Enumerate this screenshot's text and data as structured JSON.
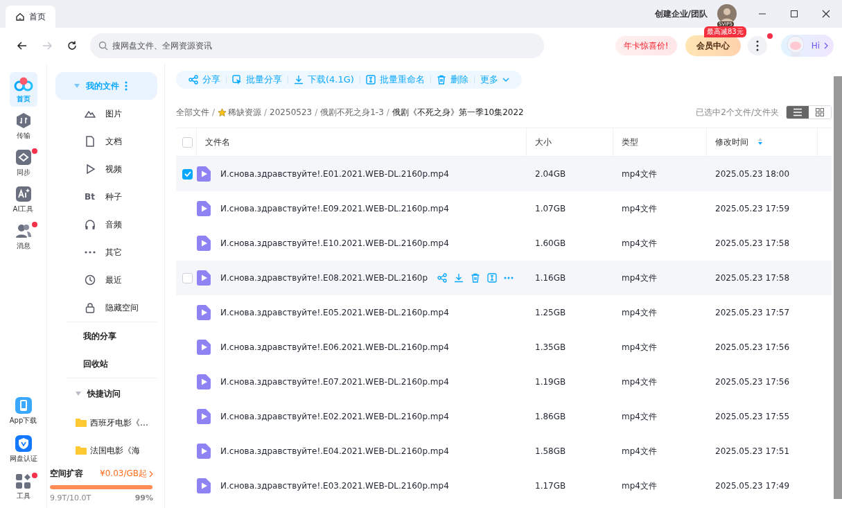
{
  "window": {
    "tab": {
      "label": "首页",
      "selected": true
    },
    "team_link": "创建企业/团队",
    "avatar_badge": "SVIP5"
  },
  "nav": {
    "forward_disabled": true,
    "search": {
      "placeholder": "搜网盘文件、全网资源资讯"
    },
    "promo": "年卡惊喜价!",
    "vip": {
      "label": "会员中心",
      "badge": "最高减83元"
    },
    "more_dot": true,
    "assistant": "Hi"
  },
  "rail": {
    "items": [
      {
        "label": "首页",
        "kind": "home",
        "selected": true,
        "dot": false
      },
      {
        "label": "传输",
        "kind": "transfer",
        "selected": false,
        "dot": false
      },
      {
        "label": "同步",
        "kind": "sync",
        "selected": false,
        "dot": true
      },
      {
        "label": "AI工具",
        "kind": "ai",
        "selected": false,
        "dot": false
      },
      {
        "label": "消息",
        "kind": "people",
        "selected": false,
        "dot": true
      }
    ],
    "bottom": [
      {
        "label": "App下载",
        "kind": "phone",
        "dot": false
      },
      {
        "label": "网盘认证",
        "kind": "shield",
        "dot": false
      },
      {
        "label": "工具",
        "kind": "grid",
        "dot": true
      }
    ]
  },
  "sidebar": {
    "my_files": {
      "label": "我的文件",
      "expanded": true,
      "selected": true
    },
    "categories": [
      {
        "label": "图片",
        "kind": "image"
      },
      {
        "label": "文档",
        "kind": "doc"
      },
      {
        "label": "视频",
        "kind": "video"
      },
      {
        "label": "种子",
        "kind": "bt"
      },
      {
        "label": "音频",
        "kind": "audio"
      },
      {
        "label": "其它",
        "kind": "other"
      },
      {
        "label": "最近",
        "kind": "recent"
      },
      {
        "label": "隐藏空间",
        "kind": "lock"
      }
    ],
    "bt_mark": "Bt",
    "links": [
      "我的分享",
      "回收站"
    ],
    "quick_access": {
      "label": "快捷访问",
      "expanded": true,
      "folders": [
        "西班牙电影《…",
        "法国电影《海"
      ]
    },
    "storage": {
      "title": "空间扩容",
      "offer": "¥0.03/GB起",
      "level": 0.99,
      "usage": "9.9T/10.0T",
      "percent": "99%"
    }
  },
  "toolbar": [
    {
      "label": "分享",
      "kind": "share"
    },
    {
      "label": "批量分享",
      "kind": "batch-share"
    },
    {
      "label": "下载(4.1G)",
      "kind": "download"
    },
    {
      "label": "批量重命名",
      "kind": "rename"
    },
    {
      "label": "删除",
      "kind": "delete"
    },
    {
      "label": "更多",
      "kind": "more"
    }
  ],
  "breadcrumb_separator": "/",
  "breadcrumb": [
    {
      "label": "全部文件",
      "starred": false
    },
    {
      "label": "稀缺资源",
      "starred": true
    },
    {
      "label": "20250523",
      "starred": false
    },
    {
      "label": "俄剧不死之身1-3",
      "starred": false
    },
    {
      "label": "俄剧《不死之身》第一季10集2022",
      "starred": false
    }
  ],
  "selection_info": "已选中2个文件/文件夹",
  "view_modes": [
    {
      "kind": "list",
      "selected": true
    },
    {
      "kind": "grid",
      "selected": false
    }
  ],
  "table": {
    "all_checked": false,
    "columns": [
      "文件名",
      "大小",
      "类型",
      "修改时间"
    ],
    "rows": [
      {
        "name": "И.снова.здравствуйте!.E01.2021.WEB-DL.2160p.mp4",
        "size": "2.04GB",
        "type": "mp4文件",
        "modified": "2025.05.23 18:00",
        "checked": true,
        "hovered": false
      },
      {
        "name": "И.снова.здравствуйте!.E09.2021.WEB-DL.2160p.mp4",
        "size": "1.07GB",
        "type": "mp4文件",
        "modified": "2025.05.23 17:59",
        "checked": false,
        "hovered": false
      },
      {
        "name": "И.снова.здравствуйте!.E10.2021.WEB-DL.2160p.mp4",
        "size": "1.60GB",
        "type": "mp4文件",
        "modified": "2025.05.23 17:58",
        "checked": false,
        "hovered": false
      },
      {
        "name": "И.снова.здравствуйте!.E08.2021.WEB-DL.2160p",
        "size": "1.16GB",
        "type": "mp4文件",
        "modified": "2025.05.23 17:58",
        "checked": false,
        "hovered": true
      },
      {
        "name": "И.снова.здравствуйте!.E05.2021.WEB-DL.2160p.mp4",
        "size": "1.25GB",
        "type": "mp4文件",
        "modified": "2025.05.23 17:57",
        "checked": false,
        "hovered": false
      },
      {
        "name": "И.снова.здравствуйте!.E06.2021.WEB-DL.2160p.mp4",
        "size": "1.35GB",
        "type": "mp4文件",
        "modified": "2025.05.23 17:56",
        "checked": false,
        "hovered": false
      },
      {
        "name": "И.снова.здравствуйте!.E07.2021.WEB-DL.2160p.mp4",
        "size": "1.19GB",
        "type": "mp4文件",
        "modified": "2025.05.23 17:56",
        "checked": false,
        "hovered": false
      },
      {
        "name": "И.снова.здравствуйте!.E02.2021.WEB-DL.2160p.mp4",
        "size": "1.86GB",
        "type": "mp4文件",
        "modified": "2025.05.23 17:55",
        "checked": false,
        "hovered": false
      },
      {
        "name": "И.снова.здравствуйте!.E04.2021.WEB-DL.2160p.mp4",
        "size": "1.58GB",
        "type": "mp4文件",
        "modified": "2025.05.23 17:51",
        "checked": false,
        "hovered": false
      },
      {
        "name": "И.снова.здравствуйте!.E03.2021.WEB-DL.2160p.mp4",
        "size": "1.17GB",
        "type": "mp4文件",
        "modified": "2025.05.23 17:49",
        "checked": false,
        "hovered": false
      }
    ]
  }
}
